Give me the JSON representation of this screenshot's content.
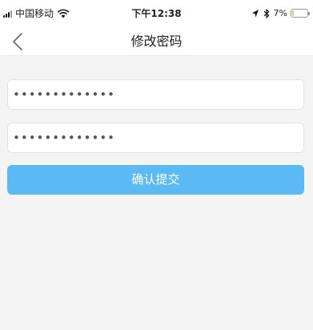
{
  "status_bar": {
    "carrier": "中国移动",
    "time": "下午12:38",
    "battery": "7%",
    "battery_level": 0.07,
    "icons": [
      "signal-icon",
      "wifi-icon",
      "location-icon",
      "bluetooth-icon",
      "battery-icon"
    ]
  },
  "nav": {
    "title": "修改密码",
    "back_icon": "chevron-left-icon"
  },
  "form": {
    "password_1_value": "•••••••••••••",
    "password_2_value": "•••••••••••••",
    "submit_label": "确认提交"
  },
  "colors": {
    "accent": "#5bbaf3",
    "background": "#f4f4f4",
    "battery_low": "#f2c94c"
  }
}
